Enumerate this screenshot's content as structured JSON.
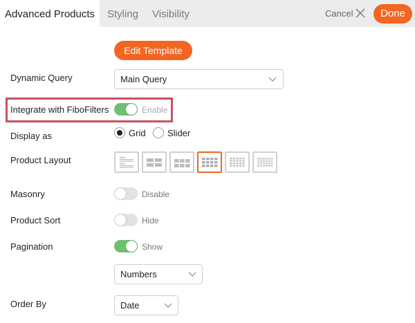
{
  "tabs": [
    {
      "label": "Advanced Products",
      "active": true
    },
    {
      "label": "Styling",
      "active": false
    },
    {
      "label": "Visibility",
      "active": false
    }
  ],
  "header": {
    "cancel_label": "Cancel",
    "done_label": "Done"
  },
  "edit_template_label": "Edit Template",
  "dynamic_query": {
    "label": "Dynamic Query",
    "value": "Main Query"
  },
  "integrate": {
    "label": "Integrate with FiboFilters",
    "state": "Enable",
    "on": true
  },
  "display_as": {
    "label": "Display as",
    "options": [
      {
        "label": "Grid",
        "selected": true
      },
      {
        "label": "Slider",
        "selected": false
      }
    ]
  },
  "product_layout": {
    "label": "Product Layout",
    "selected_index": 3,
    "options": [
      "list-layout-icon",
      "grid-2-col-icon",
      "grid-3-col-icon",
      "grid-4-col-icon",
      "grid-5-col-icon",
      "grid-6-col-icon"
    ]
  },
  "masonry": {
    "label": "Masonry",
    "state": "Disable",
    "on": false
  },
  "product_sort": {
    "label": "Product Sort",
    "state": "Hide",
    "on": false
  },
  "pagination": {
    "label": "Pagination",
    "state": "Show",
    "on": true,
    "type_value": "Numbers"
  },
  "order_by": {
    "label": "Order By",
    "value": "Date"
  },
  "colors": {
    "accent": "#f26522",
    "toggle_on": "#6cc070",
    "toggle_off": "#e2e2e2",
    "highlight": "#c6525d"
  }
}
